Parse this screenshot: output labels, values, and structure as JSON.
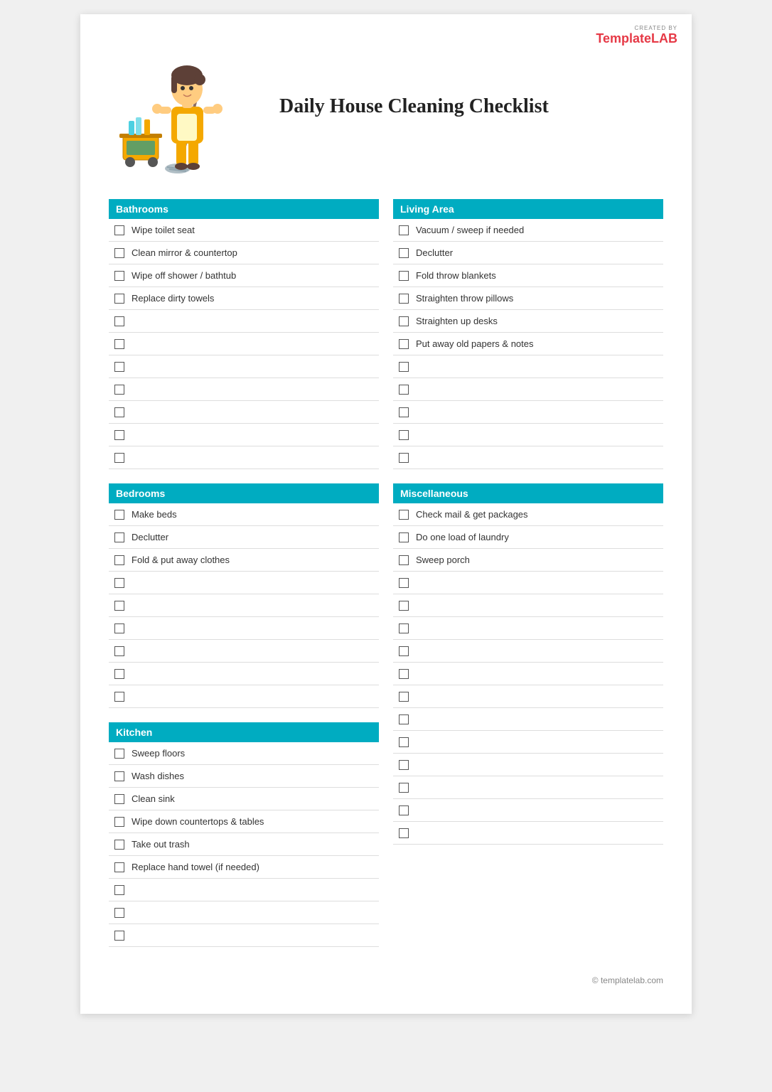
{
  "logo": {
    "created_by": "CREATED BY",
    "brand_template": "Template",
    "brand_lab": "LAB"
  },
  "title": "Daily House Cleaning Checklist",
  "sections": {
    "bathrooms": {
      "header": "Bathrooms",
      "items": [
        "Wipe toilet seat",
        "Clean mirror & countertop",
        "Wipe off shower / bathtub",
        "Replace dirty towels",
        "",
        "",
        "",
        "",
        "",
        "",
        ""
      ]
    },
    "bedrooms": {
      "header": "Bedrooms",
      "items": [
        "Make beds",
        "Declutter",
        "Fold & put away clothes",
        "",
        "",
        "",
        "",
        "",
        ""
      ]
    },
    "kitchen": {
      "header": "Kitchen",
      "items": [
        "Sweep floors",
        "Wash dishes",
        "Clean sink",
        "Wipe down countertops & tables",
        "Take out trash",
        "Replace hand towel (if needed)",
        "",
        "",
        ""
      ]
    },
    "living_area": {
      "header": "Living Area",
      "items": [
        "Vacuum / sweep if needed",
        "Declutter",
        "Fold throw blankets",
        "Straighten throw pillows",
        "Straighten up desks",
        "Put away old papers & notes",
        "",
        "",
        "",
        "",
        ""
      ]
    },
    "miscellaneous": {
      "header": "Miscellaneous",
      "items": [
        "Check mail & get packages",
        "Do one load of laundry",
        "Sweep porch",
        "",
        "",
        "",
        "",
        "",
        "",
        "",
        "",
        "",
        "",
        "",
        ""
      ]
    }
  },
  "footer": "© templatelab.com"
}
